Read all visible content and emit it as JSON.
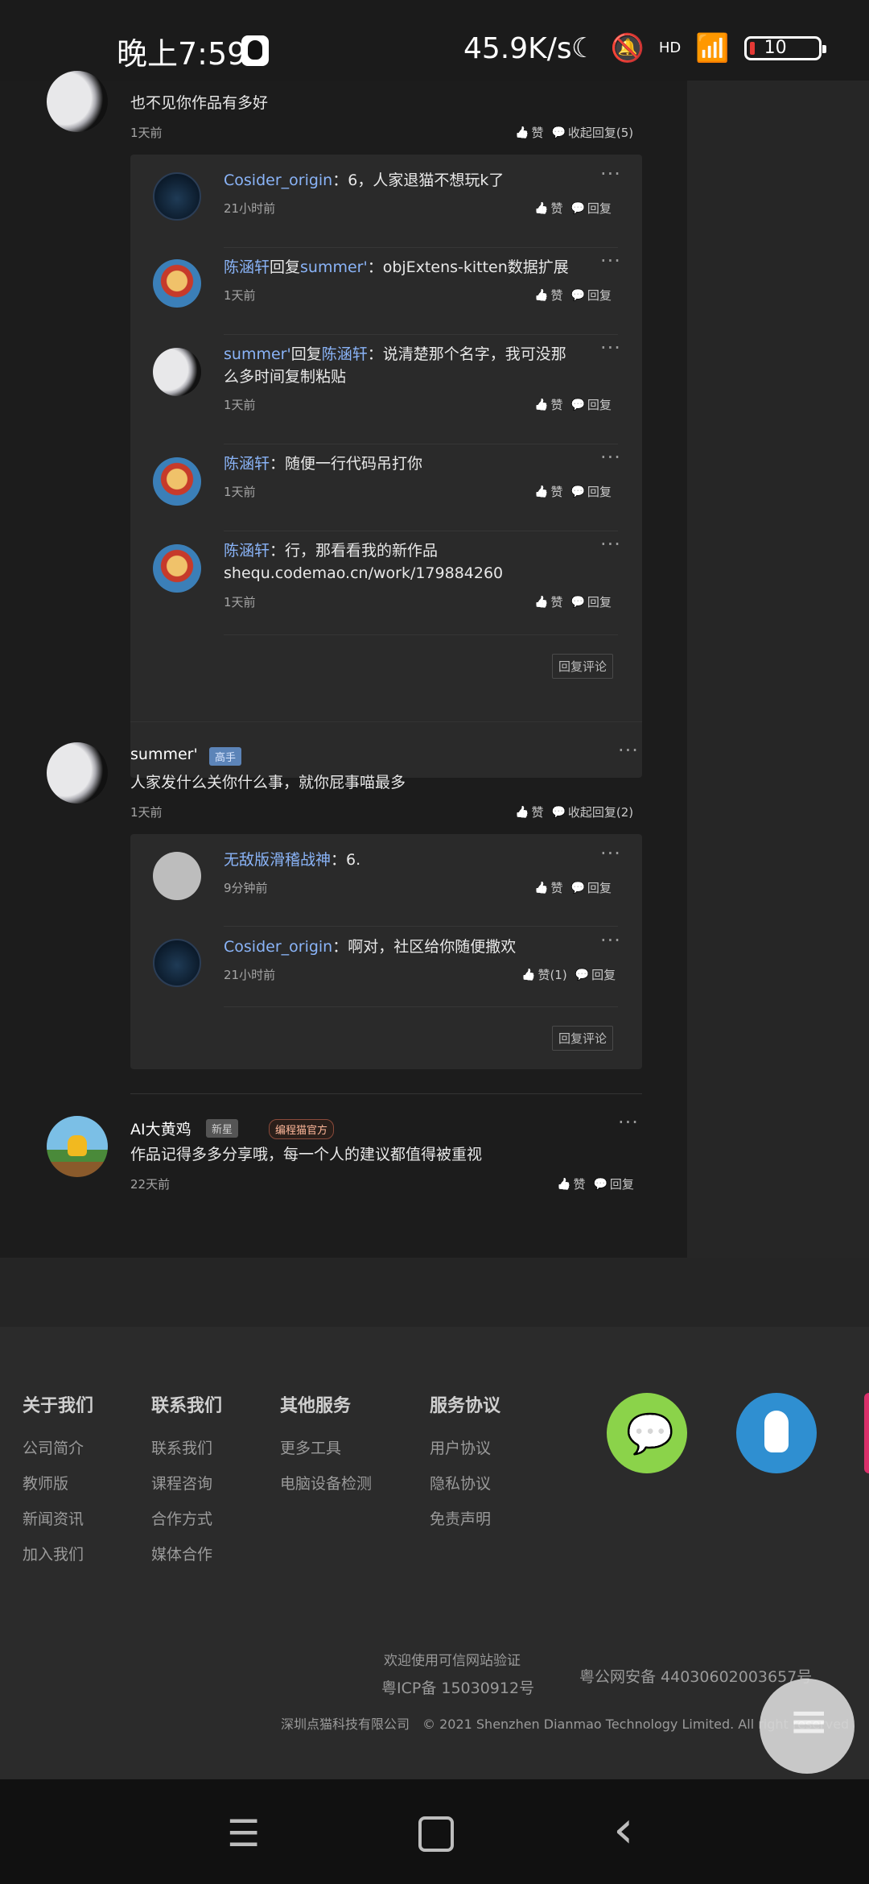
{
  "status_bar": {
    "time": "晚上7:59",
    "net_speed": "45.9K/s",
    "moon_icon": "☾",
    "bell_icon": "🔕",
    "signal": "HD",
    "wifi_icon": "📶",
    "battery": "10"
  },
  "comments": [
    {
      "name": "summer'",
      "text": "也不见你作品有多好",
      "time": "1天前",
      "like": "赞",
      "collapse": "收起回复(5)",
      "replies": [
        {
          "name": "Cosider_origin",
          "reply_word": "",
          "target": "",
          "text": "：6，人家退猫不想玩k了",
          "time": "21小时前",
          "like": "赞",
          "reply": "回复"
        },
        {
          "name": "陈涵轩",
          "reply_word": "回复",
          "target": "summer'",
          "text": "：objExtens-kitten数据扩展",
          "time": "1天前",
          "like": "赞",
          "reply": "回复"
        },
        {
          "name": "summer'",
          "reply_word": "回复",
          "target": "陈涵轩",
          "text": "：说清楚那个名字，我可没那么多时间复制粘贴",
          "time": "1天前",
          "like": "赞",
          "reply": "回复"
        },
        {
          "name": "陈涵轩",
          "reply_word": "",
          "target": "",
          "text": "：随便一行代码吊打你",
          "time": "1天前",
          "like": "赞",
          "reply": "回复"
        },
        {
          "name": "陈涵轩",
          "reply_word": "",
          "target": "",
          "text": "：行，那看看我的新作品 shequ.codemao.cn/work/179884260",
          "time": "1天前",
          "like": "赞",
          "reply": "回复"
        }
      ],
      "reply_comment": "回复评论"
    },
    {
      "name": "summer'",
      "badge": "高手",
      "text": "人家发什么关你什么事，就你屁事喵最多",
      "time": "1天前",
      "like": "赞",
      "collapse": "收起回复(2)",
      "replies": [
        {
          "name": "无敌版滑稽战神",
          "text": "：6.",
          "time": "9分钟前",
          "like": "赞",
          "reply": "回复"
        },
        {
          "name": "Cosider_origin",
          "text": "：啊对，社区给你随便撒欢",
          "time": "21小时前",
          "like": "赞(1)",
          "reply": "回复"
        }
      ],
      "reply_comment": "回复评论"
    },
    {
      "name": "AI大黄鸡",
      "badge_new": "新星",
      "badge_official": "编程猫官方",
      "text": "作品记得多多分享哦，每一个人的建议都值得被重视",
      "time": "22天前",
      "like": "赞",
      "reply": "回复"
    }
  ],
  "footer": {
    "cols": [
      {
        "title": "关于我们",
        "items": [
          "公司简介",
          "教师版",
          "新闻资讯",
          "加入我们"
        ]
      },
      {
        "title": "联系我们",
        "items": [
          "联系我们",
          "课程咨询",
          "合作方式",
          "媒体合作"
        ]
      },
      {
        "title": "其他服务",
        "items": [
          "更多工具",
          "电脑设备检测"
        ]
      },
      {
        "title": "服务协议",
        "items": [
          "用户协议",
          "隐私协议",
          "免责声明"
        ]
      }
    ],
    "verify": "欢迎使用可信网站验证",
    "icp": "粤ICP备 15030912号",
    "police": "粤公网安备 44030602003657号",
    "copyright": "深圳点猫科技有限公司　© 2021 Shenzhen Dianmao Technology Limited. All right reserved"
  },
  "nav": {
    "menu_icon": "☰",
    "back_icon": "‹"
  }
}
